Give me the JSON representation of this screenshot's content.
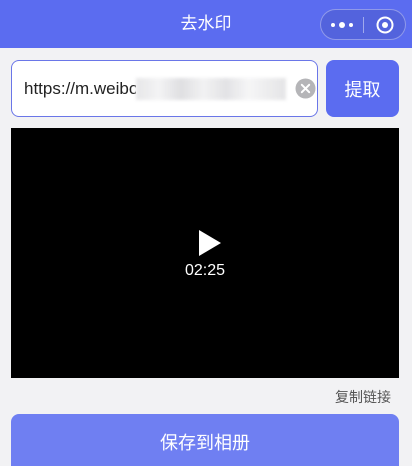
{
  "nav": {
    "title": "去水印"
  },
  "url_input": {
    "value": "https://m.weibo"
  },
  "extract_button": {
    "label": "提取"
  },
  "video": {
    "duration": "02:25"
  },
  "copy_link": {
    "label": "复制链接"
  },
  "save_button": {
    "label": "保存到相册"
  },
  "colors": {
    "accent": "#5b6cf0",
    "save_button": "#6f7ff2",
    "video_background": "#000000"
  },
  "icons": {
    "more": "more-dots-icon",
    "close": "target-circle-icon",
    "clear": "clear-x-circle-icon",
    "play": "play-triangle-icon"
  }
}
